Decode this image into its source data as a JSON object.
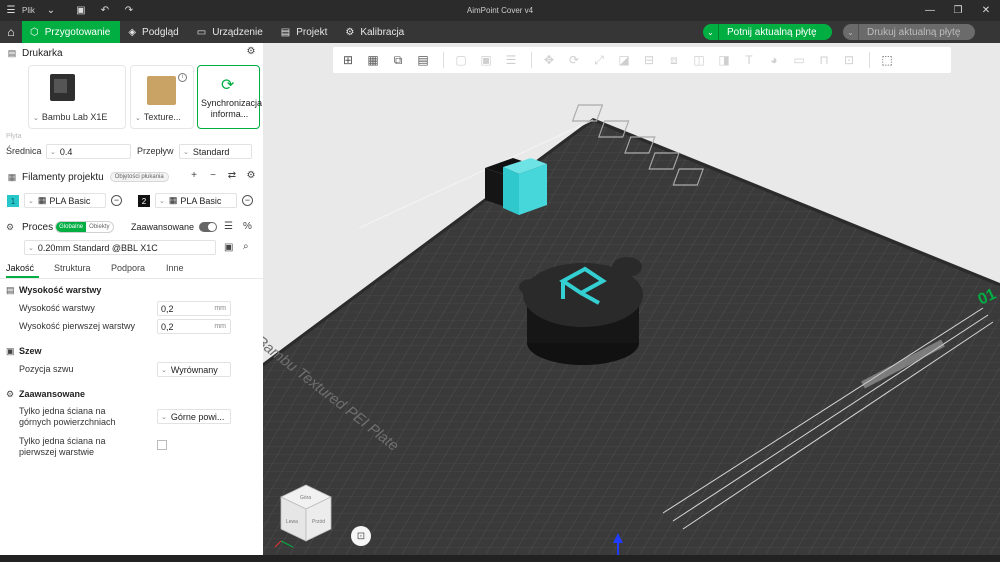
{
  "titlebar": {
    "file_label": "Plik",
    "app_title": "AimPoint Cover v4"
  },
  "nav": {
    "tabs": [
      {
        "label": "Przygotowanie",
        "icon": "cube-outline-icon"
      },
      {
        "label": "Podgląd",
        "icon": "layers-icon"
      },
      {
        "label": "Urządzenie",
        "icon": "monitor-icon"
      },
      {
        "label": "Projekt",
        "icon": "document-icon"
      },
      {
        "label": "Kalibracja",
        "icon": "gear-icon"
      }
    ],
    "slice_plate": "Potnij aktualną płytę",
    "print_plate": "Drukuj aktualną płytę"
  },
  "printer_section": {
    "title": "Drukarka",
    "printer_name": "Bambu Lab X1E",
    "plate_type": "Texture...",
    "sync_label": "Synchronizacja informa...",
    "plate_caption": "Płyta"
  },
  "nozzle": {
    "diameter_label": "Średnica",
    "diameter_value": "0.4",
    "flow_label": "Przepływ",
    "flow_value": "Standard"
  },
  "filaments": {
    "title": "Filamenty projektu",
    "pill": "Objętości płukania",
    "items": [
      {
        "num": "1",
        "name": "PLA Basic",
        "color": "#27c6c9"
      },
      {
        "num": "2",
        "name": "PLA Basic",
        "color": "#111111"
      }
    ]
  },
  "process": {
    "title": "Proces",
    "seg_global": "Globalne",
    "seg_objects": "Obiekty",
    "advanced_label": "Zaawansowane",
    "profile": "0.20mm Standard @BBL X1C"
  },
  "subtabs": [
    "Jakość",
    "Struktura",
    "Podpora",
    "Inne"
  ],
  "groups": {
    "layer_height": {
      "title": "Wysokość warstwy",
      "layer_label": "Wysokość warstwy",
      "layer_value": "0,2",
      "first_label": "Wysokość pierwszej warstwy",
      "first_value": "0,2",
      "unit": "mm"
    },
    "seam": {
      "title": "Szew",
      "pos_label": "Pozycja szwu",
      "pos_value": "Wyrównany"
    },
    "advanced": {
      "title": "Zaawansowane",
      "top_only_label": "Tylko jedna ściana na górnych powierzchniach",
      "top_only_value": "Górne powi...",
      "first_only_label": "Tylko jedna ściana na pierwszej warstwie"
    }
  },
  "viewport": {
    "plate_text": "Bambu Textured PEI Plate",
    "plate_number": "01",
    "cube_labels": {
      "top": "Góra",
      "left": "Lewa",
      "front": "Przód"
    }
  }
}
